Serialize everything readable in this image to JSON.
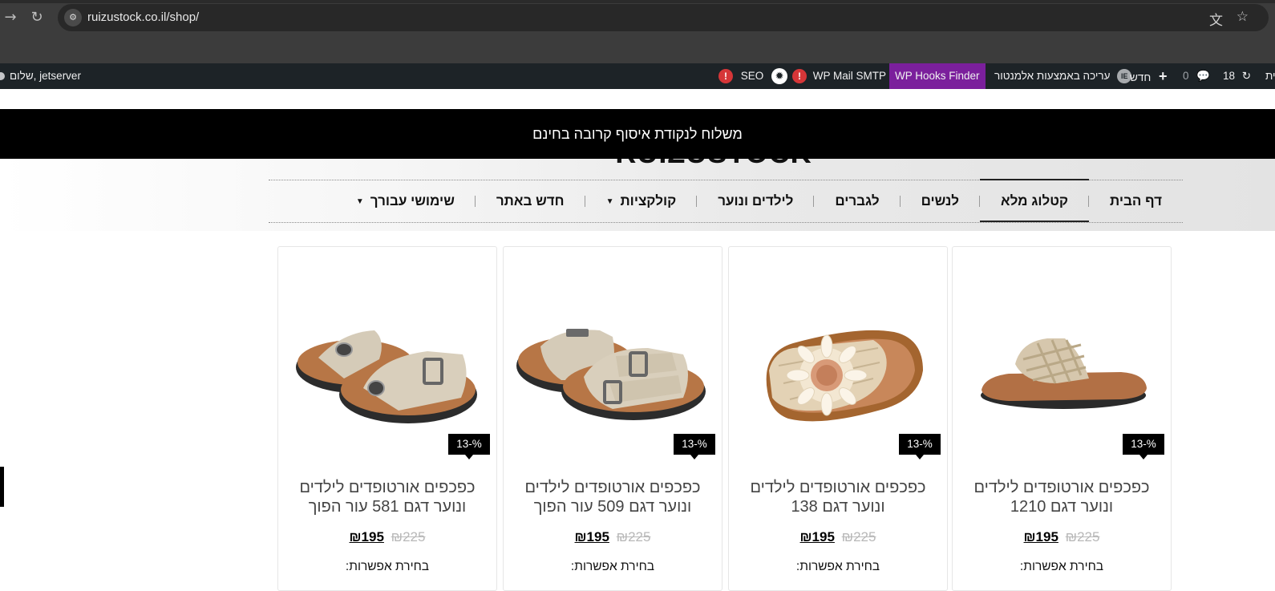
{
  "browser": {
    "url": "ruizustock.co.il/shop/",
    "icons": [
      "forward-icon",
      "reload-icon",
      "site-info-icon",
      "translate-icon",
      "bookmark-star-icon"
    ]
  },
  "adminbar": {
    "user_greeting": "שלום, jetserver",
    "seo_label": "SEO",
    "seo_alert": "!",
    "smtp_label": "WP Mail SMTP",
    "smtp_alert": "!",
    "hooks_label": "WP Hooks Finder",
    "elementor_label": "עריכה באמצעות אלמנטור",
    "elementor_icon_text": "IE",
    "new_label": "חדש",
    "comments_count": "0",
    "updates_count": "18",
    "site_partial": "ית"
  },
  "announcement": "משלוח לנקודת איסוף קרובה בחינם",
  "logo_text": "RUIZUSTOCK",
  "nav": {
    "items": [
      {
        "label": "דף הבית",
        "active": false,
        "dropdown": false
      },
      {
        "label": "קטלוג מלא",
        "active": true,
        "dropdown": false
      },
      {
        "label": "לנשים",
        "active": false,
        "dropdown": false
      },
      {
        "label": "לגברים",
        "active": false,
        "dropdown": false
      },
      {
        "label": "לילדים ונוער",
        "active": false,
        "dropdown": false
      },
      {
        "label": "קולקציות",
        "active": false,
        "dropdown": true
      },
      {
        "label": "חדש באתר",
        "active": false,
        "dropdown": false
      },
      {
        "label": "שימושי עבורך",
        "active": false,
        "dropdown": true
      }
    ]
  },
  "products": [
    {
      "title": "כפכפים אורטופדים לילדים ונוער דגם 1210",
      "badge": "13-%",
      "old_price": "₪225",
      "new_price": "₪195",
      "options": "בחירת אפשרות:",
      "image": "woven-slide-sandal"
    },
    {
      "title": "כפכפים אורטופדים לילדים ונוער דגם 138",
      "badge": "13-%",
      "old_price": "₪225",
      "new_price": "₪195",
      "options": "בחירת אפשרות:",
      "image": "sunflower-slide-sandal"
    },
    {
      "title": "כפכפים אורטופדים לילדים ונוער דגם 509 עור הפוך",
      "badge": "13-%",
      "old_price": "₪225",
      "new_price": "₪195",
      "options": "בחירת אפשרות:",
      "image": "two-strap-buckle-sandal"
    },
    {
      "title": "כפכפים אורטופדים לילדים ונוער דגם 581 עור הפוך",
      "badge": "13-%",
      "old_price": "₪225",
      "new_price": "₪195",
      "options": "בחירת אפשרות:",
      "image": "thong-buckle-sandal"
    }
  ],
  "colors": {
    "admin_bar": "#1d2327",
    "hooks_finder": "#7b1f9c",
    "alert_red": "#d63638",
    "announcement_bg": "#000000"
  }
}
